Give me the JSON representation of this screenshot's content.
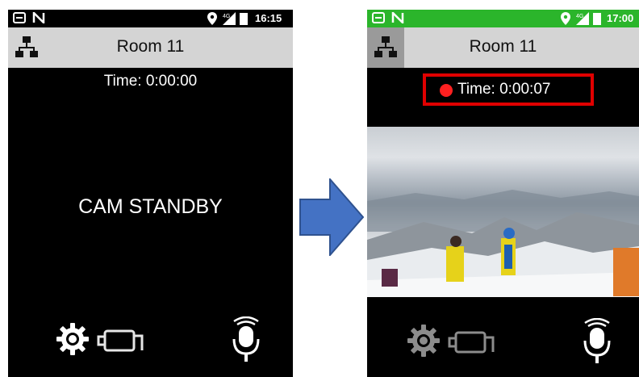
{
  "left_screen": {
    "status_time": "16:15",
    "room_title": "Room 11",
    "timer_text": "Time: 0:00:00",
    "standby_text": "CAM STANDBY"
  },
  "right_screen": {
    "status_time": "17:00",
    "room_title": "Room 11",
    "timer_text": "Time: 0:00:07",
    "recording": true
  },
  "icons": {
    "network": "network-icon",
    "settings": "gear-icon",
    "camera": "camera-off-icon",
    "microphone": "microphone-icon",
    "arrow": "right-arrow-icon"
  },
  "colors": {
    "highlight_border": "#e00000",
    "recording_dot": "#ff2020",
    "status_bar_active": "#2bb52b",
    "arrow": "#4472c4"
  }
}
